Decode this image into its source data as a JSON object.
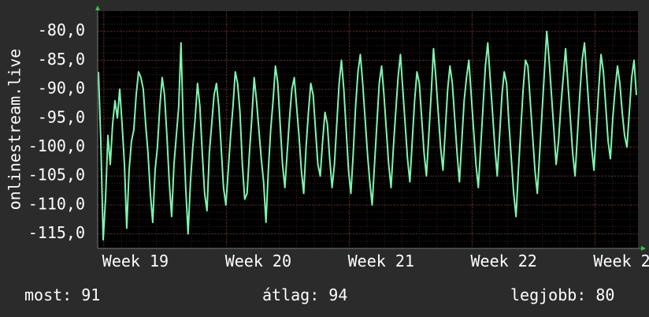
{
  "colors": {
    "background": "#2b2b2b",
    "plot_background": "#000000",
    "grid": "#5a2a2a",
    "line": "#7ff5b0",
    "axis_arrow": "#2ecc40",
    "text": "#ffffff"
  },
  "stats": {
    "now": "most: 91",
    "avg": "átlag: 94",
    "best": "legjobb: 80"
  },
  "chart_data": {
    "type": "line",
    "title": "",
    "ylabel": "onlinestream.live",
    "xlabel": "",
    "ylim": [
      -117.5,
      -76.5
    ],
    "yticks": [
      -80,
      -85,
      -90,
      -95,
      -100,
      -105,
      -110,
      -115
    ],
    "ytick_labels": [
      "-80,0",
      "-85,0",
      "-90,0",
      "-95,0",
      "-100,0",
      "-105,0",
      "-110,0",
      "-115,0"
    ],
    "xlim": [
      18.95,
      23.35
    ],
    "xticks": [
      19,
      20,
      21,
      22,
      23
    ],
    "xtick_labels": [
      "Week 19",
      "Week 20",
      "Week 21",
      "Week 22",
      "Week 2"
    ],
    "grid": true,
    "series": [
      {
        "values": [
          -87,
          -99,
          -116,
          -109,
          -98,
          -103,
          -96,
          -92,
          -95,
          -90,
          -96,
          -103,
          -114,
          -104,
          -99,
          -97,
          -91,
          -87,
          -88,
          -90,
          -96,
          -101,
          -108,
          -113,
          -104,
          -100,
          -93,
          -88,
          -91,
          -98,
          -106,
          -112,
          -103,
          -98,
          -93,
          -82,
          -97,
          -107,
          -115,
          -106,
          -100,
          -95,
          -89,
          -93,
          -101,
          -108,
          -111,
          -101,
          -96,
          -91,
          -89,
          -93,
          -100,
          -107,
          -110,
          -104,
          -98,
          -93,
          -87,
          -89,
          -94,
          -103,
          -109,
          -108,
          -101,
          -95,
          -88,
          -92,
          -97,
          -102,
          -106,
          -113,
          -104,
          -97,
          -92,
          -86,
          -89,
          -96,
          -103,
          -107,
          -101,
          -95,
          -90,
          -88,
          -93,
          -98,
          -104,
          -108,
          -100,
          -94,
          -89,
          -91,
          -97,
          -103,
          -105,
          -99,
          -94,
          -96,
          -102,
          -107,
          -103,
          -96,
          -89,
          -85,
          -90,
          -97,
          -104,
          -108,
          -101,
          -93,
          -87,
          -84,
          -89,
          -95,
          -101,
          -106,
          -110,
          -103,
          -96,
          -89,
          -86,
          -91,
          -97,
          -103,
          -107,
          -100,
          -94,
          -88,
          -84,
          -90,
          -96,
          -102,
          -106,
          -99,
          -92,
          -87,
          -89,
          -95,
          -101,
          -105,
          -98,
          -91,
          -83,
          -88,
          -94,
          -100,
          -104,
          -97,
          -90,
          -86,
          -89,
          -95,
          -101,
          -106,
          -99,
          -92,
          -88,
          -85,
          -91,
          -97,
          -103,
          -107,
          -100,
          -93,
          -86,
          -82,
          -88,
          -94,
          -100,
          -105,
          -98,
          -91,
          -87,
          -89,
          -96,
          -102,
          -108,
          -112,
          -104,
          -97,
          -90,
          -85,
          -86,
          -92,
          -98,
          -104,
          -108,
          -101,
          -94,
          -87,
          -80,
          -85,
          -91,
          -97,
          -103,
          -99,
          -93,
          -88,
          -83,
          -89,
          -95,
          -101,
          -105,
          -98,
          -91,
          -85,
          -82,
          -88,
          -94,
          -100,
          -104,
          -97,
          -90,
          -84,
          -87,
          -93,
          -99,
          -102,
          -95,
          -90,
          -86,
          -89,
          -94,
          -98,
          -100,
          -94,
          -88,
          -85,
          -91
        ]
      }
    ]
  }
}
